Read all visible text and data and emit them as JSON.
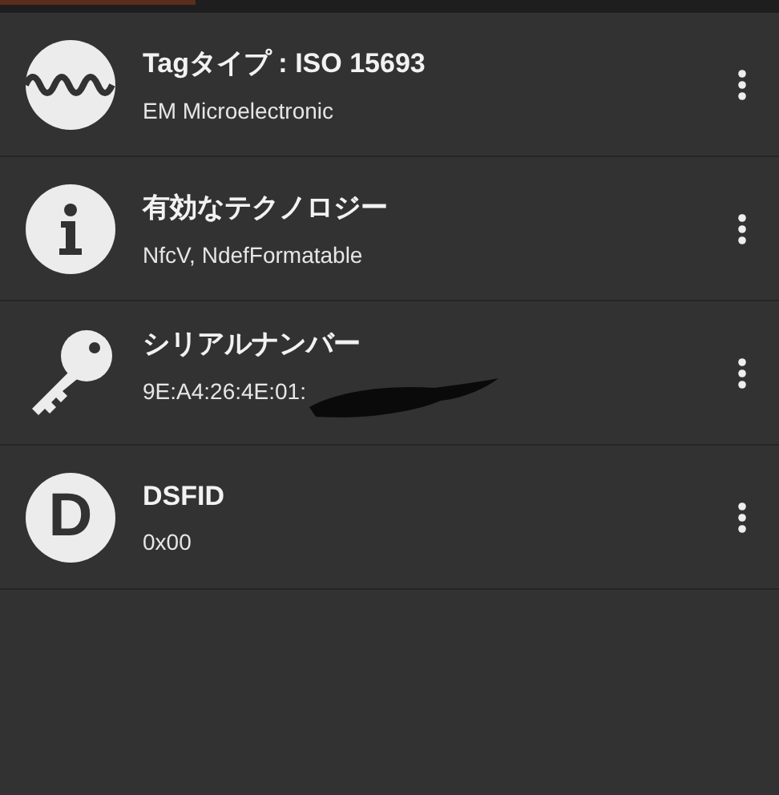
{
  "items": [
    {
      "kind": "wave",
      "title": "Tagタイプ : ISO 15693",
      "subtitle": "EM Microelectronic"
    },
    {
      "kind": "info",
      "title": "有効なテクノロジー",
      "subtitle": "NfcV, NdefFormatable"
    },
    {
      "kind": "key",
      "title": "シリアルナンバー",
      "subtitle": "9E:A4:26:4E:01:",
      "redacted": true
    },
    {
      "kind": "letter",
      "letter": "D",
      "title": "DSFID",
      "subtitle": "0x00"
    }
  ]
}
